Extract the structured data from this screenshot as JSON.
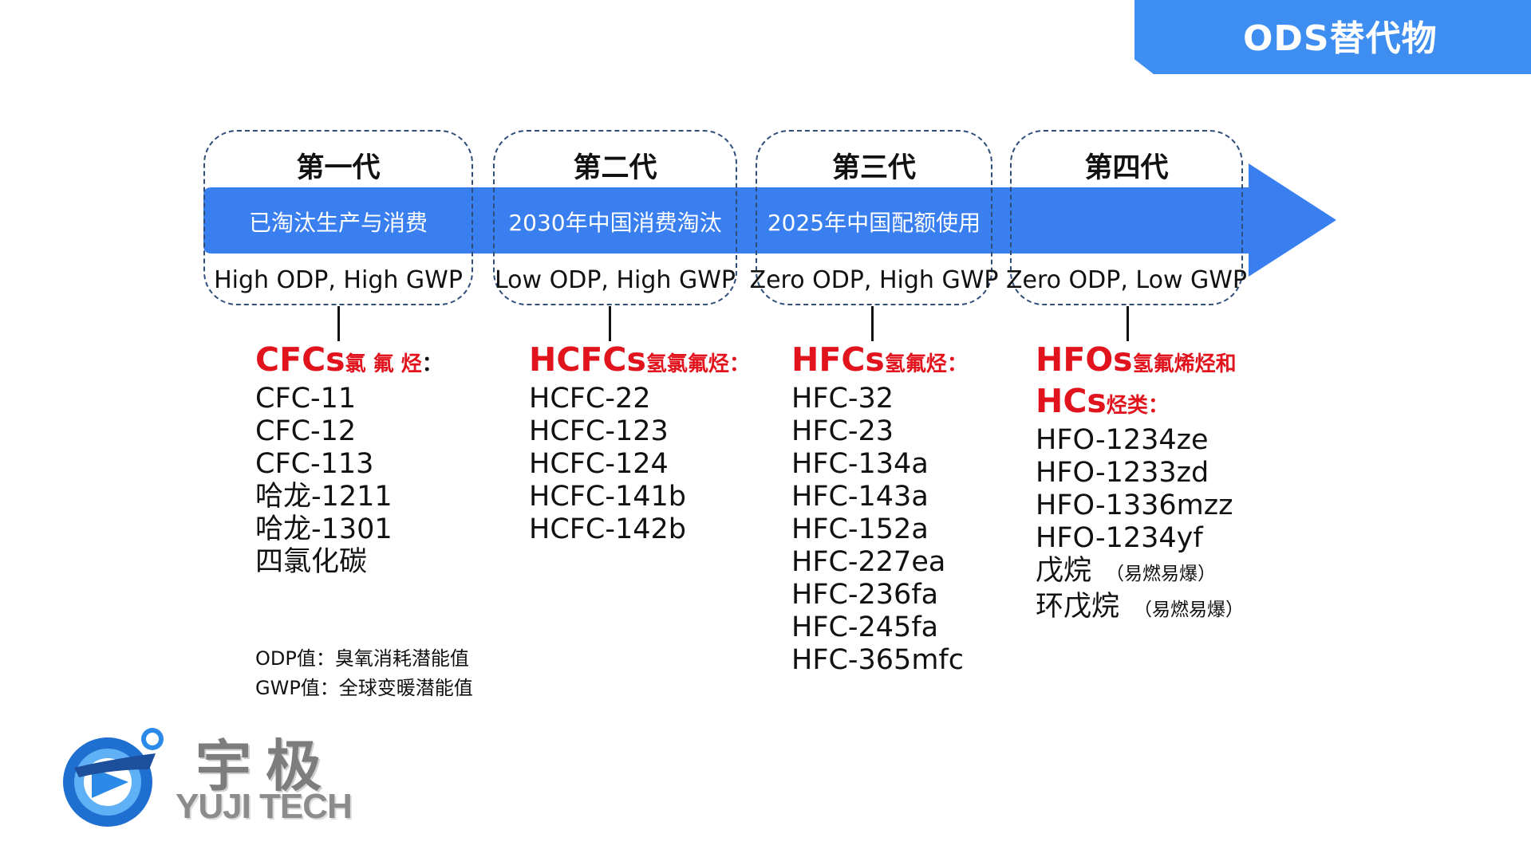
{
  "header": {
    "title": "ODS替代物"
  },
  "timeline": {
    "generations": [
      {
        "title": "第一代",
        "status": "已淘汰生产与消费",
        "odp_gwp": "High ODP, High GWP"
      },
      {
        "title": "第二代",
        "status": "2030年中国消费淘汰",
        "odp_gwp": "Low ODP, High GWP"
      },
      {
        "title": "第三代",
        "status": "2025年中国配额使用",
        "odp_gwp": "Zero ODP, High GWP"
      },
      {
        "title": "第四代",
        "status": "",
        "odp_gwp": "Zero ODP, Low GWP"
      }
    ]
  },
  "columns": [
    {
      "head_code": "CFCs",
      "head_name": "氯 氟 烃",
      "colon": "：",
      "items": [
        "CFC-11",
        "CFC-12",
        "CFC-113",
        "哈龙-1211",
        "哈龙-1301",
        "四氯化碳"
      ]
    },
    {
      "head_code": "HCFCs",
      "head_name": "氢氯氟烃：",
      "items": [
        "HCFC-22",
        "HCFC-123",
        "HCFC-124",
        "HCFC-141b",
        "HCFC-142b"
      ]
    },
    {
      "head_code": "HFCs",
      "head_name": "氢氟烃：",
      "items": [
        "HFC-32",
        "HFC-23",
        "HFC-134a",
        "HFC-143a",
        "HFC-152a",
        "HFC-227ea",
        "HFC-236fa",
        "HFC-245fa",
        "HFC-365mfc"
      ]
    },
    {
      "head_code": "HFOs",
      "head_name": "氢氟烯烃和",
      "head_code2": "HCs",
      "head_name2": "烃类：",
      "items": [
        "HFO-1234ze",
        "HFO-1233zd",
        "HFO-1336mzz",
        "HFO-1234yf",
        "戊烷",
        "环戊烷"
      ],
      "notes": {
        "4": "（易燃易爆）",
        "5": "（易燃易爆）"
      }
    }
  ],
  "notes": {
    "odp": "ODP值：臭氧消耗潜能值",
    "gwp": "GWP值：全球变暖潜能值"
  },
  "logo": {
    "cn": "宇极",
    "en": "YUJI TECH"
  },
  "colors": {
    "accent": "#3d8ef0",
    "arrow": "#3a7ff0",
    "red": "#e1141e",
    "dash": "#2f4e79"
  }
}
